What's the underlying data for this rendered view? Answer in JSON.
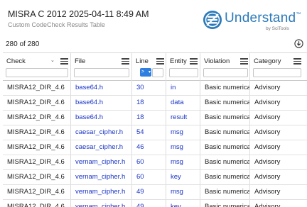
{
  "header": {
    "title": "MISRA C 2012 2025-04-11 8:49 AM",
    "subtitle": "Custom CodeCheck Results Table",
    "logo_word": "Understand",
    "logo_tm": "™",
    "logo_by": "by SciTools"
  },
  "results": {
    "count_text": "280 of 280"
  },
  "colors": {
    "link": "#1a35c4",
    "brand": "#2b79b9",
    "select_accent": "#2f7fe0"
  },
  "columns": [
    {
      "label": "Check",
      "filter": "",
      "sortable": true
    },
    {
      "label": "File",
      "filter": ""
    },
    {
      "label": "Line",
      "filter_operator": ">",
      "filter": ""
    },
    {
      "label": "Entity",
      "filter": ""
    },
    {
      "label": "Violation",
      "filter": ""
    },
    {
      "label": "Category",
      "filter": ""
    }
  ],
  "rows": [
    {
      "check": "MISRA12_DIR_4.6",
      "file": "base64.h",
      "line": "30",
      "entity": "in",
      "violation": "Basic numerical",
      "category": "Advisory"
    },
    {
      "check": "MISRA12_DIR_4.6",
      "file": "base64.h",
      "line": "18",
      "entity": "data",
      "violation": "Basic numerical",
      "category": "Advisory"
    },
    {
      "check": "MISRA12_DIR_4.6",
      "file": "base64.h",
      "line": "18",
      "entity": "result",
      "violation": "Basic numerical",
      "category": "Advisory"
    },
    {
      "check": "MISRA12_DIR_4.6",
      "file": "caesar_cipher.h",
      "line": "54",
      "entity": "msg",
      "violation": "Basic numerical",
      "category": "Advisory"
    },
    {
      "check": "MISRA12_DIR_4.6",
      "file": "caesar_cipher.h",
      "line": "46",
      "entity": "msg",
      "violation": "Basic numerical",
      "category": "Advisory"
    },
    {
      "check": "MISRA12_DIR_4.6",
      "file": "vernam_cipher.h",
      "line": "60",
      "entity": "msg",
      "violation": "Basic numerical",
      "category": "Advisory"
    },
    {
      "check": "MISRA12_DIR_4.6",
      "file": "vernam_cipher.h",
      "line": "60",
      "entity": "key",
      "violation": "Basic numerical",
      "category": "Advisory"
    },
    {
      "check": "MISRA12_DIR_4.6",
      "file": "vernam_cipher.h",
      "line": "49",
      "entity": "msg",
      "violation": "Basic numerical",
      "category": "Advisory"
    },
    {
      "check": "MISRA12_DIR_4.6",
      "file": "vernam_cipher.h",
      "line": "49",
      "entity": "key",
      "violation": "Basic numerical",
      "category": "Advisory"
    }
  ]
}
